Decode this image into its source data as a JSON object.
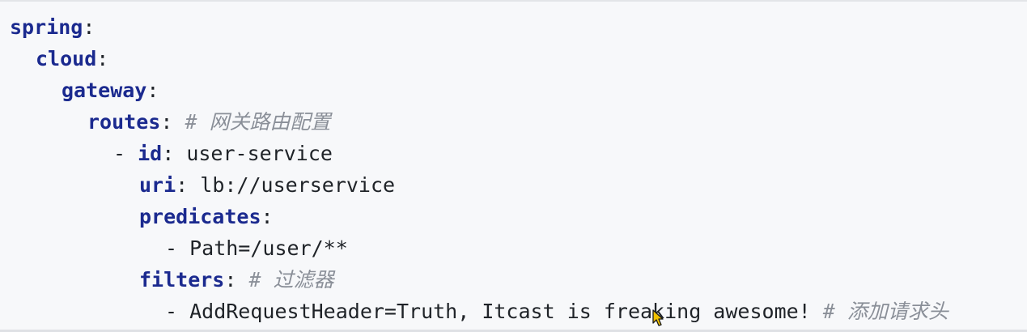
{
  "editor": {
    "lines": {
      "l1": {
        "key": "spring",
        "colon": ":"
      },
      "l2": {
        "key": "cloud",
        "colon": ":"
      },
      "l3": {
        "key": "gateway",
        "colon": ":"
      },
      "l4": {
        "key": "routes",
        "colon": ":",
        "comment": "# 网关路由配置"
      },
      "l5": {
        "dash": "- ",
        "key": "id",
        "colon": ":",
        "value": " user-service"
      },
      "l6": {
        "key": "uri",
        "colon": ":",
        "value": " lb://userservice"
      },
      "l7": {
        "key": "predicates",
        "colon": ":"
      },
      "l8": {
        "value": "- Path=/user/**"
      },
      "l9": {
        "key": "filters",
        "colon": ":",
        "comment": "# 过滤器"
      },
      "l10": {
        "value": "- AddRequestHeader=Truth, Itcast is freaking awesome! ",
        "comment": "# 添加请求头"
      }
    },
    "colors": {
      "key": "#1b2a8f",
      "text": "#1f2328",
      "comment": "#8a8f98",
      "background": "#f7f8fa"
    }
  },
  "mouse_cursor": {
    "icon": "arrow-cursor-icon"
  }
}
